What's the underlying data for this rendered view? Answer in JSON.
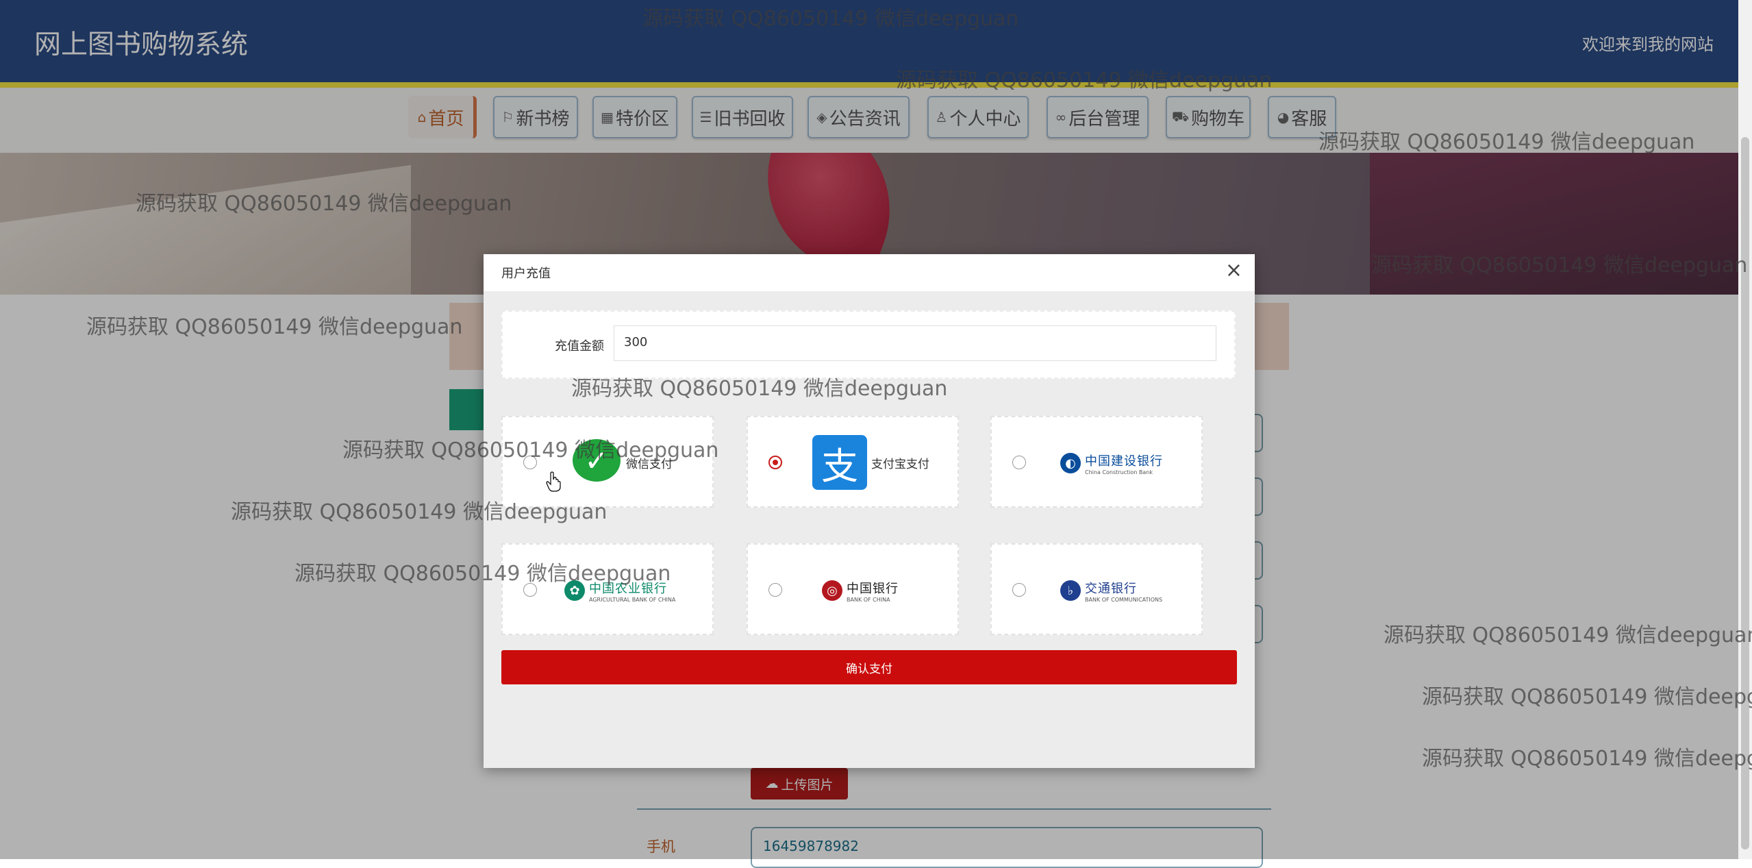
{
  "header": {
    "title": "网上图书购物系统",
    "welcome": "欢迎来到我的网站"
  },
  "nav": {
    "items": [
      {
        "label": "首页",
        "icon": "home-icon",
        "glyph": "⌂"
      },
      {
        "label": "新书榜",
        "icon": "flag-icon",
        "glyph": "⚐"
      },
      {
        "label": "特价区",
        "icon": "grid-icon",
        "glyph": "▦"
      },
      {
        "label": "旧书回收",
        "icon": "sliders-icon",
        "glyph": "☰"
      },
      {
        "label": "公告资讯",
        "icon": "layers-icon",
        "glyph": "◈"
      },
      {
        "label": "个人中心",
        "icon": "user-icon",
        "glyph": "♙"
      },
      {
        "label": "后台管理",
        "icon": "link-icon",
        "glyph": "∞"
      },
      {
        "label": "购物车",
        "icon": "cart-icon",
        "glyph": "⛟"
      },
      {
        "label": "客服",
        "icon": "chat-icon",
        "glyph": "◕"
      }
    ]
  },
  "page": {
    "upload_label": "上传图片",
    "phone_label": "手机",
    "phone_value": "16459878982"
  },
  "modal": {
    "title": "用户充值",
    "close": "×",
    "amount_label": "充值金额",
    "amount_value": "300",
    "confirm_label": "确认支付",
    "options": [
      {
        "id": "wechat",
        "label": "微信支付",
        "selected": false
      },
      {
        "id": "alipay",
        "label": "支付宝支付",
        "selected": true
      },
      {
        "id": "ccb",
        "bank_cn": "中国建设银行",
        "bank_en": "China Construction Bank",
        "selected": false
      },
      {
        "id": "abc",
        "bank_cn": "中国农业银行",
        "bank_en": "AGRICULTURAL BANK OF CHINA",
        "selected": false
      },
      {
        "id": "boc",
        "bank_cn": "中国银行",
        "bank_en": "BANK OF CHINA",
        "selected": false
      },
      {
        "id": "bocom",
        "bank_cn": "交通银行",
        "bank_en": "BANK OF COMMUNICATIONS",
        "selected": false
      }
    ]
  },
  "watermark": "源码获取 QQ86050149 微信deepguan",
  "colors": {
    "header": "#2b4c86",
    "accent_yellow": "#f6e543",
    "confirm": "#cb0c0c",
    "active_nav": "#c0632b"
  }
}
